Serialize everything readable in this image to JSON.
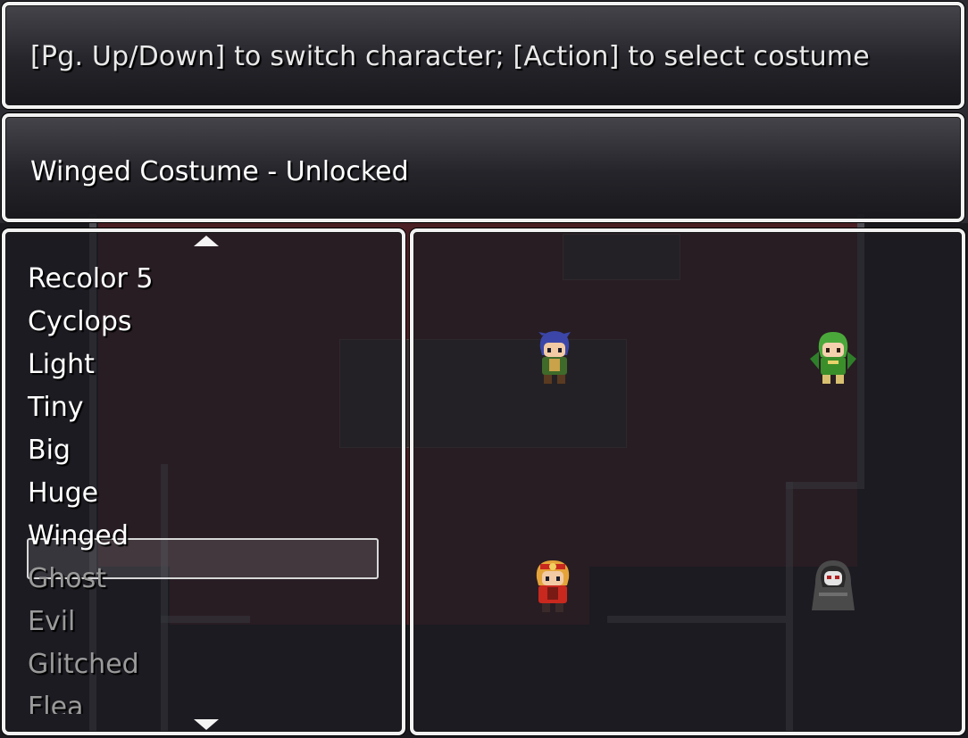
{
  "help": {
    "text": "[Pg. Up/Down] to switch character; [Action] to select costume"
  },
  "status": {
    "text": "Winged Costume - Unlocked"
  },
  "costume_list": {
    "selected": "Winged",
    "items": [
      {
        "label": "Recolor 5",
        "locked": false
      },
      {
        "label": "Cyclops",
        "locked": false
      },
      {
        "label": "Light",
        "locked": false
      },
      {
        "label": "Tiny",
        "locked": false
      },
      {
        "label": "Big",
        "locked": false
      },
      {
        "label": "Huge",
        "locked": false
      },
      {
        "label": "Winged",
        "locked": false
      },
      {
        "label": "Ghost",
        "locked": true
      },
      {
        "label": "Evil",
        "locked": true
      },
      {
        "label": "Glitched",
        "locked": true
      },
      {
        "label": "Flea",
        "locked": true
      }
    ]
  },
  "preview": {
    "characters": [
      {
        "name": "blue-haired-hero",
        "hair": "#3b46a8",
        "outfit": "#3f6a2a"
      },
      {
        "name": "green-hooded-winged",
        "hair": "#4aa83a",
        "outfit": "#3a8f2a"
      },
      {
        "name": "red-armored-blonde",
        "hair": "#e5a43a",
        "outfit": "#c8281e"
      },
      {
        "name": "grey-hooded-masked",
        "hair": "#6e6e6e",
        "outfit": "#4a4a4a"
      }
    ]
  },
  "colors": {
    "window_border": "#f2f2f2",
    "locked_text": "#9a9a9a",
    "text": "#ffffff"
  }
}
